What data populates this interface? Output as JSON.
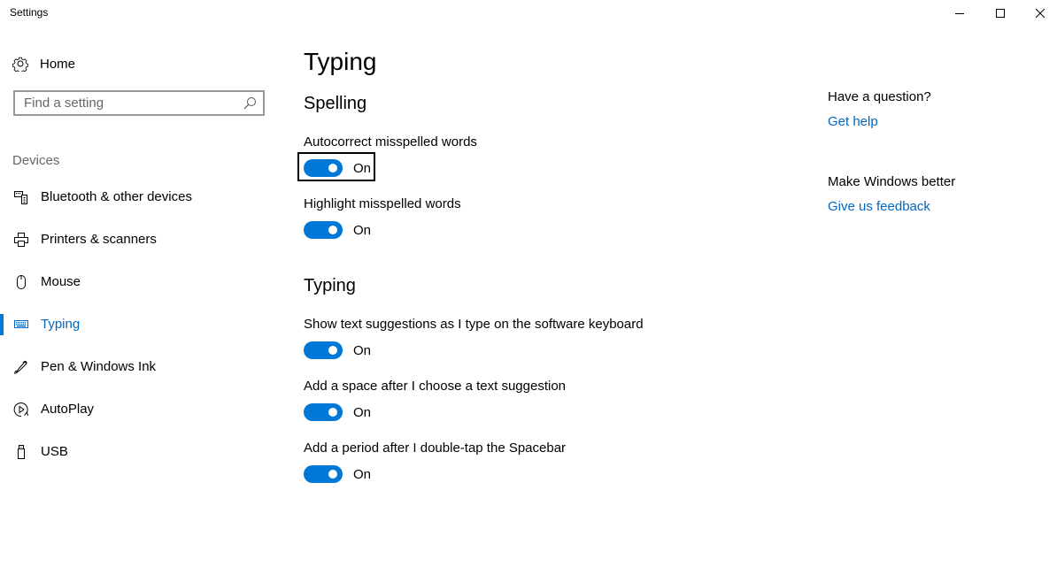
{
  "window": {
    "title": "Settings",
    "controls": {
      "minimize": "minimize-icon",
      "maximize": "maximize-icon",
      "close": "close-icon"
    }
  },
  "sidebar": {
    "home_label": "Home",
    "home_icon": "gear-icon",
    "search_placeholder": "Find a setting",
    "search_value": "",
    "section_label": "Devices",
    "items": [
      {
        "label": "Bluetooth & other devices",
        "icon": "bluetooth-devices-icon",
        "selected": false
      },
      {
        "label": "Printers & scanners",
        "icon": "printer-icon",
        "selected": false
      },
      {
        "label": "Mouse",
        "icon": "mouse-icon",
        "selected": false
      },
      {
        "label": "Typing",
        "icon": "keyboard-icon",
        "selected": true
      },
      {
        "label": "Pen & Windows Ink",
        "icon": "pen-icon",
        "selected": false
      },
      {
        "label": "AutoPlay",
        "icon": "autoplay-icon",
        "selected": false
      },
      {
        "label": "USB",
        "icon": "usb-icon",
        "selected": false
      }
    ]
  },
  "main": {
    "title": "Typing",
    "groups": [
      {
        "title": "Spelling",
        "settings": [
          {
            "label": "Autocorrect misspelled words",
            "state": "On",
            "checked": true,
            "focused": true
          },
          {
            "label": "Highlight misspelled words",
            "state": "On",
            "checked": true,
            "focused": false
          }
        ]
      },
      {
        "title": "Typing",
        "settings": [
          {
            "label": "Show text suggestions as I type on the software keyboard",
            "state": "On",
            "checked": true,
            "focused": false
          },
          {
            "label": "Add a space after I choose a text suggestion",
            "state": "On",
            "checked": true,
            "focused": false
          },
          {
            "label": "Add a period after I double-tap the Spacebar",
            "state": "On",
            "checked": true,
            "focused": false
          }
        ]
      }
    ]
  },
  "aside": {
    "question_heading": "Have a question?",
    "help_link": "Get help",
    "feedback_heading": "Make Windows better",
    "feedback_link": "Give us feedback"
  },
  "colors": {
    "accent": "#0078d7",
    "link": "#0067c0",
    "section_label": "#666666"
  }
}
